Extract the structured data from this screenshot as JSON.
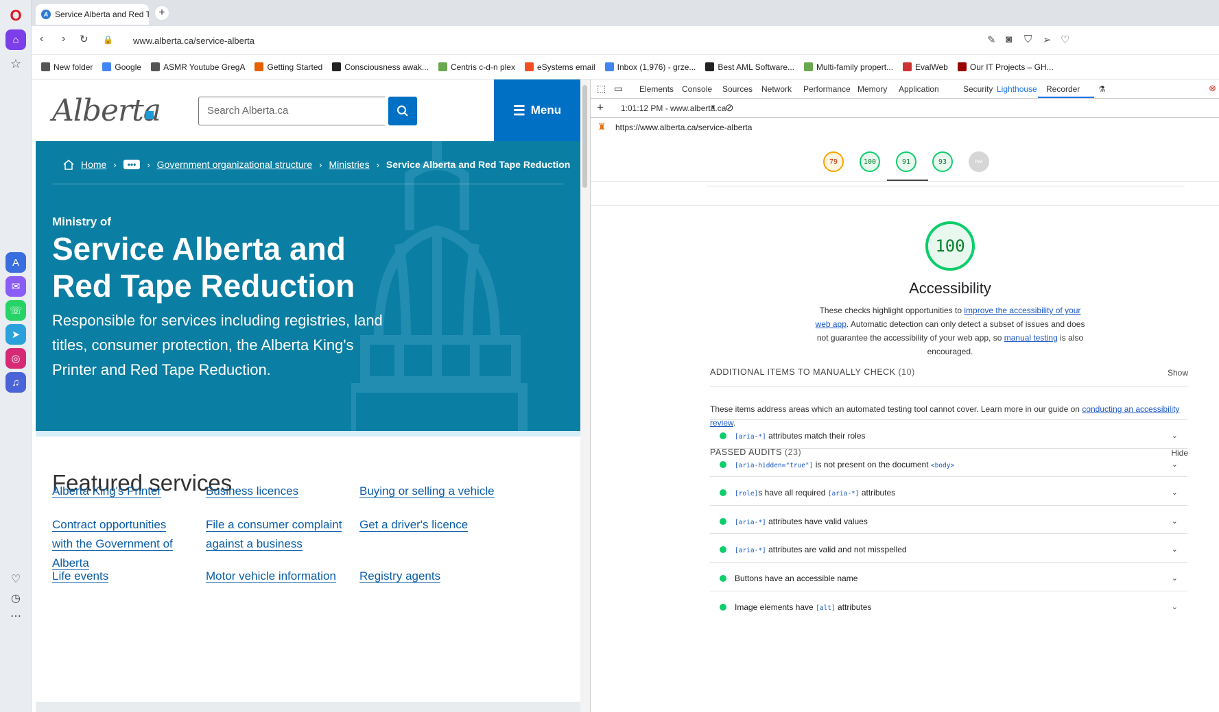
{
  "browser": {
    "tab_title": "Service Alberta and Red T",
    "new_tab": "+",
    "url": "www.alberta.ca/service-alberta",
    "bookmarks": [
      {
        "label": "New folder",
        "icon": "folder-icon",
        "color": "#555555"
      },
      {
        "label": "Google",
        "icon": "google-icon",
        "color": "#4285f4"
      },
      {
        "label": "ASMR Youtube GregA",
        "icon": "folder-icon",
        "color": "#555555"
      },
      {
        "label": "Getting Started",
        "icon": "firefox-icon",
        "color": "#e66000"
      },
      {
        "label": "Consciousness awak...",
        "icon": "amazon-icon",
        "color": "#222222"
      },
      {
        "label": "Centris c-d-n plex",
        "icon": "centris-icon",
        "color": "#6aa84f"
      },
      {
        "label": "eSystems email",
        "icon": "microsoft-icon",
        "color": "#f25022"
      },
      {
        "label": "Inbox (1,976) - grze...",
        "icon": "google-icon",
        "color": "#4285f4"
      },
      {
        "label": "Best AML Software...",
        "icon": "arrow-icon",
        "color": "#222222"
      },
      {
        "label": "Multi-family propert...",
        "icon": "centris-icon",
        "color": "#6aa84f"
      },
      {
        "label": "EvalWeb",
        "icon": "evalweb-icon",
        "color": "#cc3333"
      },
      {
        "label": "Our IT Projects – GH...",
        "icon": "ghost-icon",
        "color": "#990000"
      }
    ]
  },
  "site": {
    "logo_text": "Alberta",
    "search_placeholder": "Search Alberta.ca",
    "menu_label": "Menu",
    "breadcrumbs": {
      "home": "Home",
      "more": "•••",
      "org": "Government organizational structure",
      "ministries": "Ministries",
      "current": "Service Alberta and Red Tape Reduction"
    },
    "ministry_of": "Ministry of",
    "title": "Service Alberta and Red Tape Reduction",
    "description": "Responsible for services including registries, land titles, consumer protection, the Alberta King's Printer and Red Tape Reduction.",
    "featured_heading": "Featured services",
    "services": [
      "Alberta King's Printer",
      "Business licences",
      "Buying or selling a vehicle",
      "Contract opportunities with the Government of Alberta",
      "File a consumer complaint against a business",
      "Get a driver's licence",
      "Life events",
      "Motor vehicle information",
      "Registry agents"
    ]
  },
  "devtools": {
    "tabs": [
      "Elements",
      "Console",
      "Sources",
      "Network",
      "Performance",
      "Memory",
      "Application",
      "Security",
      "Lighthouse",
      "Recorder"
    ],
    "active_tab": "Lighthouse",
    "report_time": "1:01:12 PM - www.alberta.ca",
    "report_url": "https://www.alberta.ca/service-alberta",
    "scores": [
      "79",
      "100",
      "91",
      "93",
      "PWA"
    ],
    "category": {
      "score": "100",
      "title": "Accessibility",
      "desc_1": "These checks highlight opportunities to ",
      "desc_link_1": "improve the accessibility of your web app",
      "desc_2": ". Automatic detection can only detect a subset of issues and does not guarantee the accessibility of your web app, so ",
      "desc_link_2": "manual testing",
      "desc_3": " is also encouraged."
    },
    "manual": {
      "heading": "ADDITIONAL ITEMS TO MANUALLY CHECK",
      "count": "(10)",
      "action": "Show",
      "desc": "These items address areas which an automated testing tool cannot cover. Learn more in our guide on ",
      "desc_link": "conducting an accessibility review",
      "desc_end": "."
    },
    "passed": {
      "heading": "PASSED AUDITS",
      "count": "(23)",
      "action": "Hide",
      "audits": [
        {
          "code1": "[aria-*]",
          "text1": " attributes match their roles",
          "code2": "",
          "text2": ""
        },
        {
          "code1": "[aria-hidden=\"true\"]",
          "text1": " is not present on the document ",
          "code2": "<body>",
          "text2": ""
        },
        {
          "code1": "[role]",
          "text1": "s have all required ",
          "code2": "[aria-*]",
          "text2": " attributes"
        },
        {
          "code1": "[aria-*]",
          "text1": " attributes have valid values",
          "code2": "",
          "text2": ""
        },
        {
          "code1": "[aria-*]",
          "text1": " attributes are valid and not misspelled",
          "code2": "",
          "text2": ""
        },
        {
          "code1": "",
          "text1": "Buttons have an accessible name",
          "code2": "",
          "text2": ""
        },
        {
          "code1": "",
          "text1": "Image elements have ",
          "code2": "[alt]",
          "text2": " attributes"
        }
      ]
    }
  }
}
